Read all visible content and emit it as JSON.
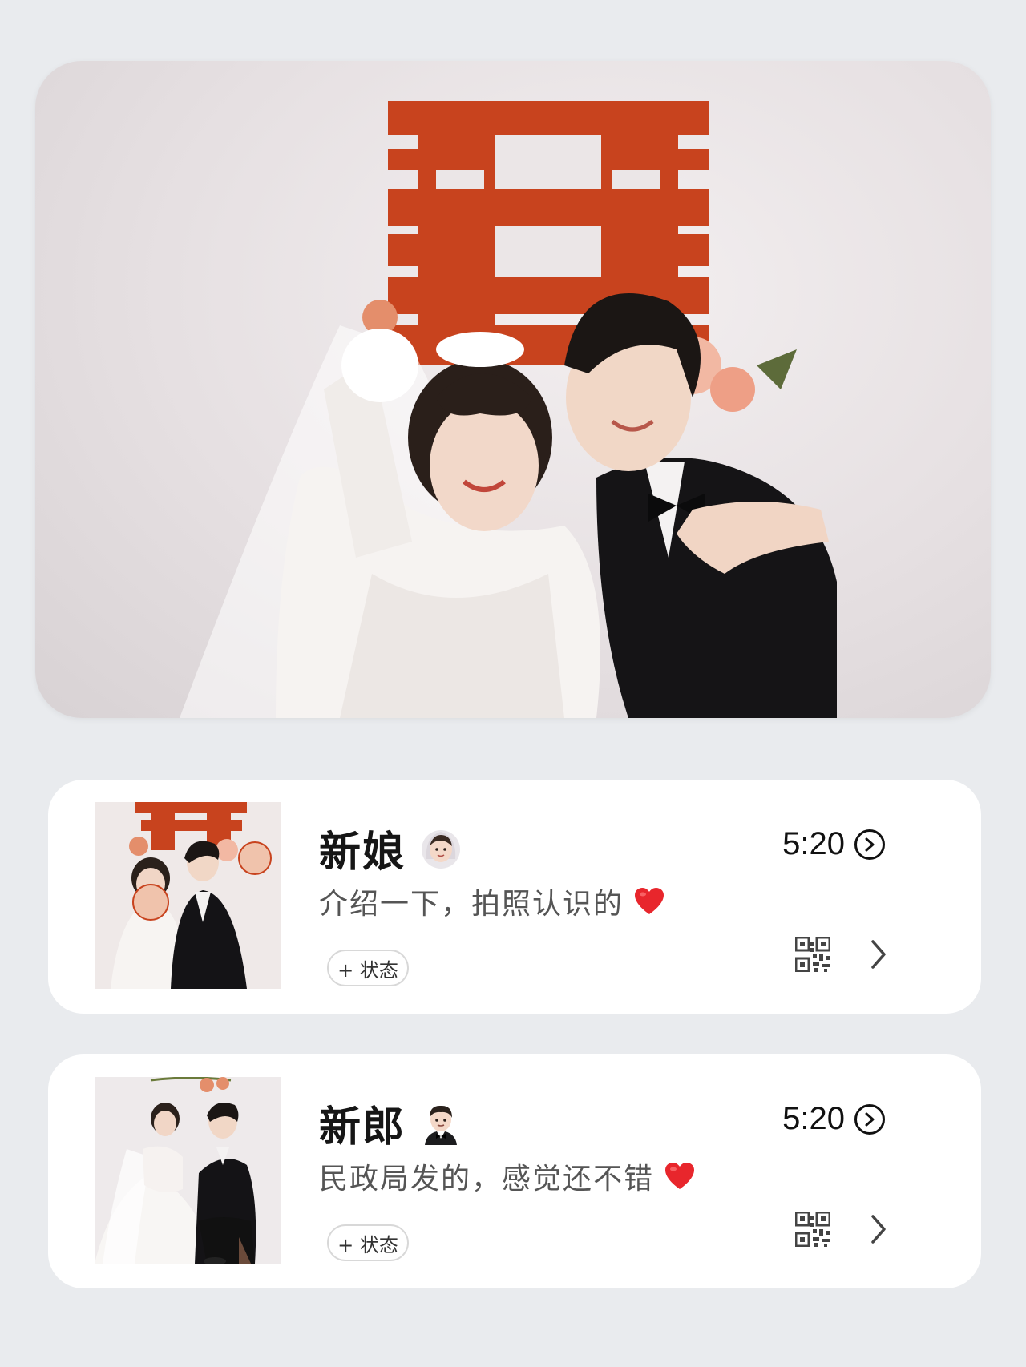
{
  "hero": {
    "photo": "wedding-couple-photo",
    "backdrop_symbol": "double-happiness-character"
  },
  "profiles": [
    {
      "name": "新娘",
      "emoji": "bride-with-veil-emoji",
      "signature": "介绍一下，拍照认识的",
      "signature_emoji": "red-heart-emoji",
      "time": "5:20",
      "status_button": "+ 状态"
    },
    {
      "name": "新郎",
      "emoji": "groom-in-tuxedo-emoji",
      "signature": "民政局发的，感觉还不错",
      "signature_emoji": "red-heart-emoji",
      "time": "5:20",
      "status_button": "+ 状态"
    }
  ],
  "colors": {
    "background": "#e9ebee",
    "card": "#ffffff",
    "accent_red": "#c8431e",
    "heart": "#e8262c"
  }
}
